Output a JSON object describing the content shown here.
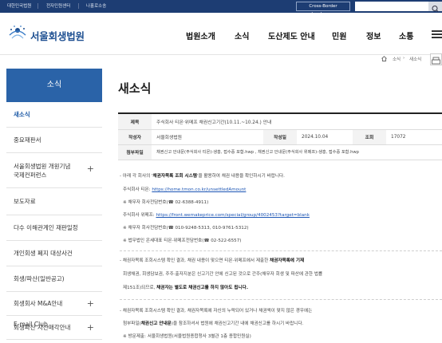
{
  "topbar": {
    "links": [
      "대한민국법원",
      "전자민원센터",
      "나홀로소송"
    ],
    "cbi_label": "Cross-Border Insolvency",
    "search_placeholder": ""
  },
  "header": {
    "logo_text": "서울회생법원",
    "nav": [
      "법원소개",
      "소식",
      "도산제도 안내",
      "민원",
      "정보",
      "소통"
    ]
  },
  "breadcrumb": {
    "items": [
      "소식",
      "새소식"
    ]
  },
  "sidebar": {
    "heading": "소식",
    "items": [
      {
        "label": "새소식",
        "active": true,
        "plus": ""
      },
      {
        "label": "중요재판서",
        "plus": ""
      },
      {
        "label": "서울회생법원 개원기념\n국제컨퍼런스",
        "plus": "+"
      },
      {
        "label": "보도자료",
        "plus": ""
      },
      {
        "label": "다수 이해관계인 재판일정",
        "plus": ""
      },
      {
        "label": "개인회생 폐지 대상사건",
        "plus": ""
      },
      {
        "label": "회생/파산(일반공고)",
        "plus": ""
      },
      {
        "label": "회생회사 M&A안내",
        "plus": "+"
      },
      {
        "label": "회생파산 자산매각안내",
        "plus": "+"
      },
      {
        "label": "E-mail Club",
        "plus": ""
      }
    ]
  },
  "page": {
    "title": "새소식"
  },
  "post": {
    "subject_label": "제목",
    "subject": "주식회사 티몬·위메프 채권신고기간(10.11.~10.24.) 안내",
    "author_label": "작성자",
    "author": "서울회생법원",
    "date_label": "작성일",
    "date": "2024.10.04",
    "views_label": "조회",
    "views": "17072",
    "attach_label": "첨부파일",
    "attach": "채권신고 안내문(주식회사 티몬)-생홍, 접수증 포함.hwp , 채권신고 안내문(주식회사 위메프)-생홍, 접수증 포함.hwp"
  },
  "content": {
    "l1a": "- 아래 각 회사의 '",
    "l1b": "채권자목록 조회 시스템",
    "l1c": "'을 활용하여 채권 내용을 확인하시기 바랍니다.",
    "l2a": "주식회사 티몬: ",
    "l2b": "https://home.tmon.co.kr/unsettledAmount",
    "l3": "※ 채무자 회사전담번호(☎ 02-6388-4911)",
    "l4a": "주식회사 위메프: ",
    "l4b": "https://front.wemakeprice.com/special/group/4002453?target=blank",
    "l5": "※ 채무자 회사전담번호(☎ 010-9248-5313, 010-9761-5312)",
    "l6": "※ 법무법인 온세대표 티몬·위메프전담번호(☎ 02-522-6557)",
    "l7a": "- 채권자목록 조회시스템 확인 결과, 채권 내용이 맞으면 티몬·위메프에서 제출한 ",
    "l7b": "채권자목록에 기재",
    "l8": "회생채권, 회생담보권, 주주·출자지분은 신고기간 안에 신고된 것으로 간주(채무자 회생 및 파산에 관한 법률",
    "l9a": "제151조)되므로, ",
    "l9b": "채권자는 별도로 채권신고를 하지 않아도 됩니다.",
    "l10a": "- 채권자목록 조회시스템 확인 결과, ",
    "l10b": "채권자목록에 자신의 누락되어 있거나 채권액이 맞지 않은 경우에는",
    "l11a": "첨부파일(",
    "l11b": "채권신고 안내문",
    "l11c": ")을 참조하셔서 법원에 채권신고기간 내에 채권신고를 하시기 바랍니다.",
    "l12": "※ 방문제출: 서울회생법원(서울법원종합청사 3별관 1층 종합민원실)"
  }
}
